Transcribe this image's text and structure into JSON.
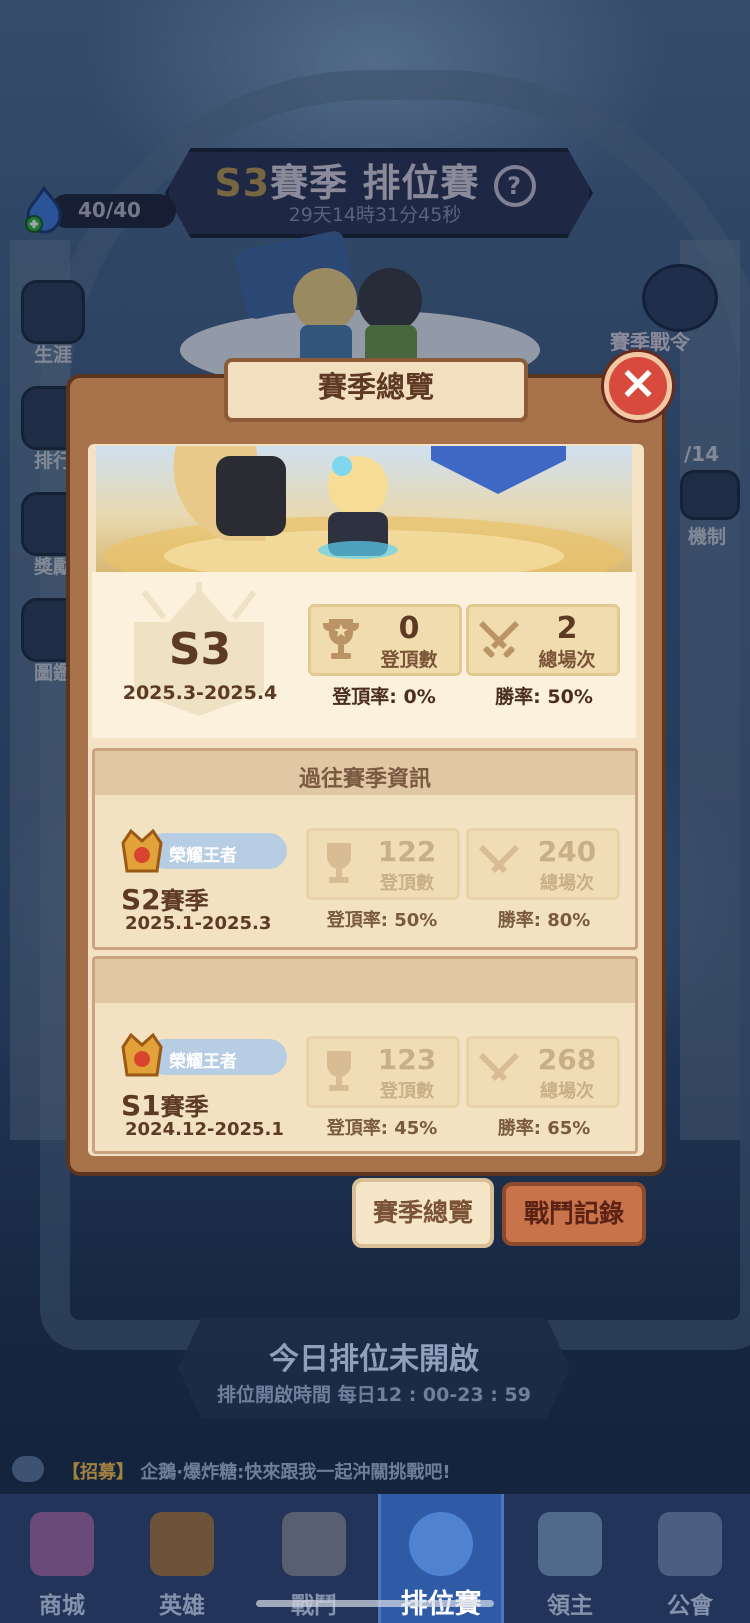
{
  "header": {
    "season_prefix": "S3",
    "title": "賽季 排位賽",
    "help_glyph": "?",
    "countdown": "29天14時31分45秒"
  },
  "energy": {
    "value": "40/40"
  },
  "side_left": [
    {
      "label": "生涯",
      "icon": "career-icon"
    },
    {
      "label": "排行",
      "icon": "ranking-icon"
    },
    {
      "label": "獎勵",
      "icon": "reward-icon"
    },
    {
      "label": "圖鑑",
      "icon": "collection-icon"
    }
  ],
  "side_right": {
    "pass_label": "賽季戰令",
    "pass_progress": "/14",
    "mechanism_label": "機制"
  },
  "modal": {
    "title": "賽季總覽",
    "close_glyph": "×",
    "current": {
      "season": "S3",
      "range": "2025.3-2025.4",
      "peak_count": "0",
      "peak_label": "登頂數",
      "total_count": "2",
      "total_label": "總場次",
      "peak_rate_label": "登頂率:",
      "peak_rate": "0%",
      "win_rate_label": "勝率:",
      "win_rate": "50%"
    },
    "past_title": "過往賽季資訊",
    "past": [
      {
        "rank": "榮耀王者",
        "season_code": "S2",
        "season_word": "賽季",
        "range": "2025.1-2025.3",
        "peak_count": "122",
        "peak_label": "登頂數",
        "total_count": "240",
        "total_label": "總場次",
        "peak_rate_label": "登頂率:",
        "peak_rate": "50%",
        "win_rate_label": "勝率:",
        "win_rate": "80%"
      },
      {
        "rank": "榮耀王者",
        "season_code": "S1",
        "season_word": "賽季",
        "range": "2024.12-2025.1",
        "peak_count": "123",
        "peak_label": "登頂數",
        "total_count": "268",
        "total_label": "總場次",
        "peak_rate_label": "登頂率:",
        "peak_rate": "45%",
        "win_rate_label": "勝率:",
        "win_rate": "65%"
      }
    ],
    "tabs": {
      "overview": "賽季總覽",
      "records": "戰鬥記錄"
    }
  },
  "status": {
    "title": "今日排位未開啟",
    "time": "排位開啟時間 每日12 : 00-23 : 59"
  },
  "chat": {
    "tag": "【招募】",
    "message": "企鵝·爆炸糖:快來跟我一起沖關挑戰吧!"
  },
  "nav": [
    {
      "label": "商城",
      "icon": "shop-icon"
    },
    {
      "label": "英雄",
      "icon": "hero-icon"
    },
    {
      "label": "戰鬥",
      "icon": "battle-icon"
    },
    {
      "label": "排位賽",
      "icon": "ranked-icon"
    },
    {
      "label": "領主",
      "icon": "lord-icon"
    },
    {
      "label": "公會",
      "icon": "guild-icon"
    }
  ],
  "colors": {
    "panel_frame": "#a8724a",
    "panel_cream": "#f3e3c4",
    "accent_gold": "#b99a54",
    "close_red": "#d84a3e",
    "nav_active": "#2f5aa6"
  }
}
